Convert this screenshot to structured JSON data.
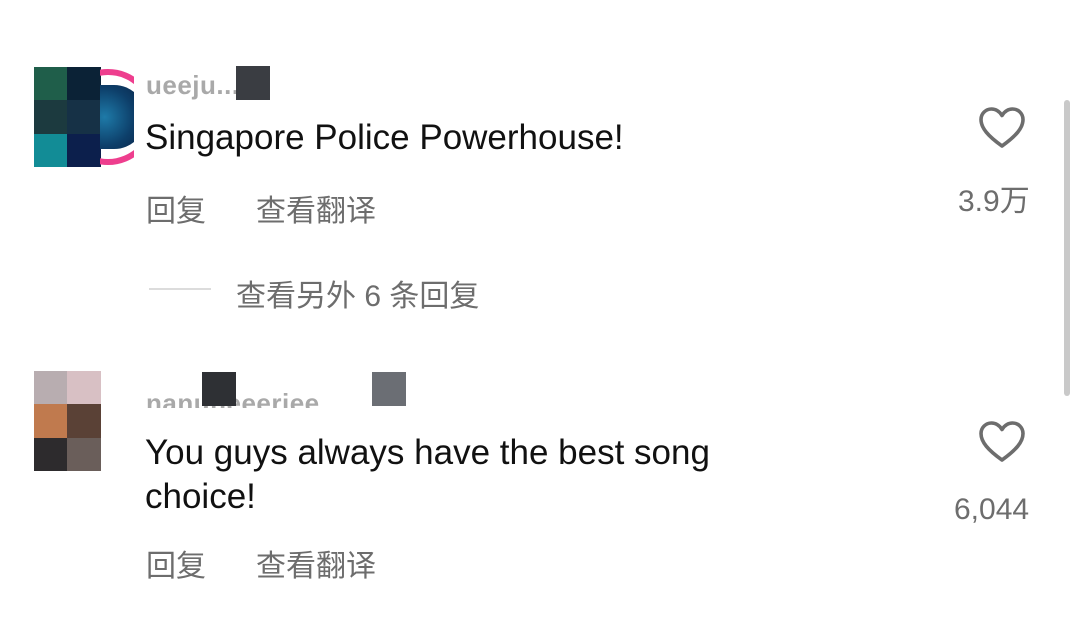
{
  "colors": {
    "text_primary": "#111111",
    "text_secondary": "#6d6d6d",
    "username_ghost": "#a9a9a9",
    "divider": "#dcdcdc",
    "scrollbar": "#c9c9c9",
    "story_ring": "#ee3e8e"
  },
  "comments": [
    {
      "username_partial": "ueeju...a",
      "avatar_has_story_ring": true,
      "text_lines": [
        "Singapore Police Powerhouse!"
      ],
      "reply_label": "回复",
      "translate_label": "查看翻译",
      "like_icon": "heart-outline-icon",
      "like_count": "3.9万",
      "more_replies_label": "查看另外 6 条回复"
    },
    {
      "username_partial": "nanuneeeriee",
      "avatar_has_story_ring": false,
      "text_lines": [
        "You guys always have the best song",
        "choice!"
      ],
      "reply_label": "回复",
      "translate_label": "查看翻译",
      "like_icon": "heart-outline-icon",
      "like_count": "6,044"
    }
  ]
}
